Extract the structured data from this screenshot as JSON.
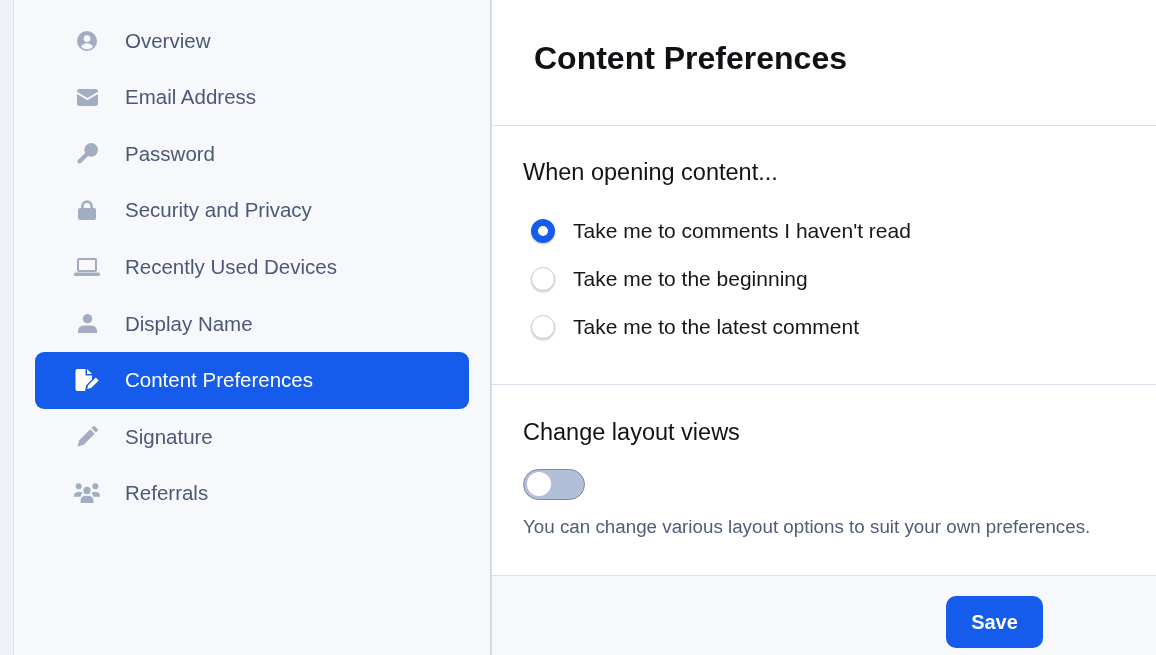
{
  "sidebar": {
    "items": [
      {
        "label": "Overview",
        "selected": false
      },
      {
        "label": "Email Address",
        "selected": false
      },
      {
        "label": "Password",
        "selected": false
      },
      {
        "label": "Security and Privacy",
        "selected": false
      },
      {
        "label": "Recently Used Devices",
        "selected": false
      },
      {
        "label": "Display Name",
        "selected": false
      },
      {
        "label": "Content Preferences",
        "selected": true
      },
      {
        "label": "Signature",
        "selected": false
      },
      {
        "label": "Referrals",
        "selected": false
      }
    ]
  },
  "page": {
    "title": "Content Preferences"
  },
  "opening_content": {
    "heading": "When opening content...",
    "options": [
      {
        "label": "Take me to comments I haven't read",
        "selected": true
      },
      {
        "label": "Take me to the beginning",
        "selected": false
      },
      {
        "label": "Take me to the latest comment",
        "selected": false
      }
    ]
  },
  "layout_views": {
    "heading": "Change layout views",
    "toggle": {
      "on": false
    },
    "description": "You can change various layout options to suit your own preferences."
  },
  "footer": {
    "save_button": "Save"
  }
}
